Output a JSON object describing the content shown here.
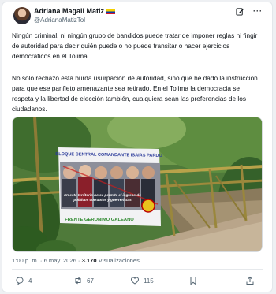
{
  "tweet": {
    "author_name": "Adriana Magali Matiz",
    "author_handle": "@AdrianaMatizTol",
    "paragraph1": "Ningún criminal, ni ningún grupo de bandidos puede tratar de imponer reglas ni fingir de autoridad para decir quién puede o no puede transitar o hacer ejercicios democráticos en el Tolima.",
    "paragraph2": "No solo rechazo esta burda usurpación de autoridad, sino que he dado la instrucción para que ese panfleto amenazante sea retirado. En el Tolima la democracia se respeta y la libertad de elección también, cualquiera sean las preferencias de los ciudadanos.",
    "time": "1:00 p. m.",
    "date": "6 may. 2026",
    "views_count": "3.170",
    "views_label": "Visualizaciones"
  },
  "banner": {
    "top_text": "BLOQUE CENTRAL COMANDANTE ISAIAS PARDO",
    "middle_text": "En este territorio no se permite el ingreso de políticos corruptos y guerreristas",
    "bottom_text": "FRENTE GERONIMO GALEANO"
  },
  "actions": {
    "replies": "4",
    "reposts": "67",
    "likes": "115"
  },
  "icons": [
    "avatar",
    "colombia-flag-icon",
    "edit-icon",
    "more-icon",
    "reply-icon",
    "repost-icon",
    "like-icon",
    "bookmark-icon",
    "share-icon"
  ],
  "colors": {
    "text": "#0f1419",
    "muted": "#536471",
    "accent_green": "#2f8a2f",
    "banner_text_blue": "#1e2a8a"
  }
}
